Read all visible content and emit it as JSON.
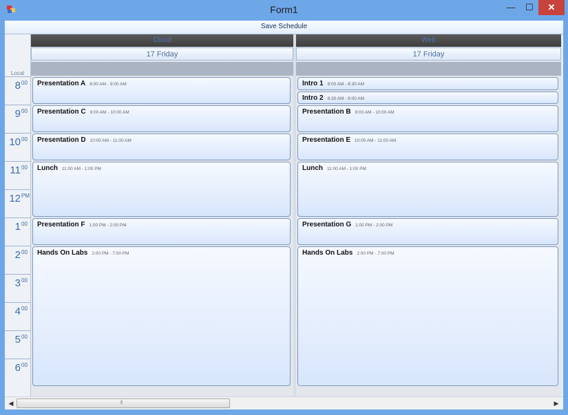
{
  "window": {
    "title": "Form1",
    "minimize": "—",
    "maximize": "☐",
    "close": "✕"
  },
  "toolbar": {
    "save_label": "Save Schedule"
  },
  "timebar": {
    "local_label": "Local",
    "hours": [
      {
        "h": "8",
        "s": "00"
      },
      {
        "h": "9",
        "s": "00"
      },
      {
        "h": "10",
        "s": "00"
      },
      {
        "h": "11",
        "s": "00"
      },
      {
        "h": "12",
        "s": "PM"
      },
      {
        "h": "1",
        "s": "00"
      },
      {
        "h": "2",
        "s": "00"
      },
      {
        "h": "3",
        "s": "00"
      },
      {
        "h": "4",
        "s": "00"
      },
      {
        "h": "5",
        "s": "00"
      },
      {
        "h": "6",
        "s": "00"
      }
    ]
  },
  "resources": [
    {
      "name": "Cloud",
      "day": "17 Friday",
      "appointments": [
        {
          "subject": "Presentation A",
          "time": "8:00 AM - 9:00 AM"
        },
        {
          "subject": "Presentation C",
          "time": "9:00 AM - 10:00 AM"
        },
        {
          "subject": "Presentation D",
          "time": "10:00 AM - 11:00 AM"
        },
        {
          "subject": "Lunch",
          "time": "11:00 AM - 1:00 PM"
        },
        {
          "subject": "Presentation F",
          "time": "1:00 PM - 2:00 PM"
        },
        {
          "subject": "Hands On Labs",
          "time": "2:00 PM - 7:00 PM"
        }
      ]
    },
    {
      "name": "Web",
      "day": "17 Friday",
      "appointments": [
        {
          "subject": "Intro 1",
          "time": "8:00 AM - 8:30 AM"
        },
        {
          "subject": "Intro 2",
          "time": "8:30 AM - 9:00 AM"
        },
        {
          "subject": "Presentation B",
          "time": "9:00 AM - 10:00 AM"
        },
        {
          "subject": "Presentation E",
          "time": "10:00 AM - 11:00 AM"
        },
        {
          "subject": "Lunch",
          "time": "11:00 AM - 1:00 PM"
        },
        {
          "subject": "Presentation G",
          "time": "1:00 PM - 2:00 PM"
        },
        {
          "subject": "Hands On Labs",
          "time": "2:00 PM - 7:00 PM"
        }
      ]
    }
  ],
  "scrollbar": {
    "left_arrow": "◀",
    "right_arrow": "▶",
    "grip": "⦀"
  }
}
